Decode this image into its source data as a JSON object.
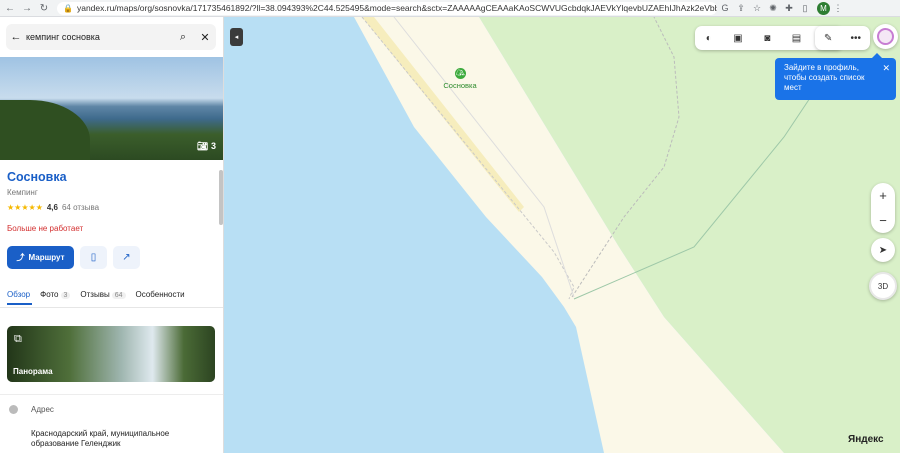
{
  "browser": {
    "url": "yandex.ru/maps/org/sosnovka/171735461892/?ll=38.094393%2C44.525495&mode=search&sctx=ZAAAAAgCEAAaKAoSCWVUGcbdqkJAEVkYlqevbUZAEhIJhAzk2eVbbz8R8lt...",
    "profile_letter": "M"
  },
  "search": {
    "query": "кемпинг сосновка"
  },
  "place": {
    "photo_count": "3",
    "name": "Сосновка",
    "category": "Кемпинг",
    "stars": "★★★★★",
    "rating": "4,6",
    "reviews": "64 отзыва",
    "status": "Больше не работает",
    "route_label": "Маршрут"
  },
  "tabs": [
    {
      "label": "Обзор"
    },
    {
      "label": "Фото",
      "count": "3"
    },
    {
      "label": "Отзывы",
      "count": "64"
    },
    {
      "label": "Особенности"
    }
  ],
  "panorama": {
    "label": "Панорама"
  },
  "address": {
    "label": "Адрес",
    "text": "Краснодарский край, муниципальное образование Геленджик"
  },
  "map": {
    "poi_label": "Сосновка",
    "tooltip": "Зайдите в профиль, чтобы создать список мест",
    "btn_3d": "3D",
    "logo": "Яндекс"
  },
  "colors": {
    "accent": "#1a5fc7",
    "water": "#b8dff4",
    "forest": "#d9f0c8",
    "status_closed": "#d32f2f"
  }
}
